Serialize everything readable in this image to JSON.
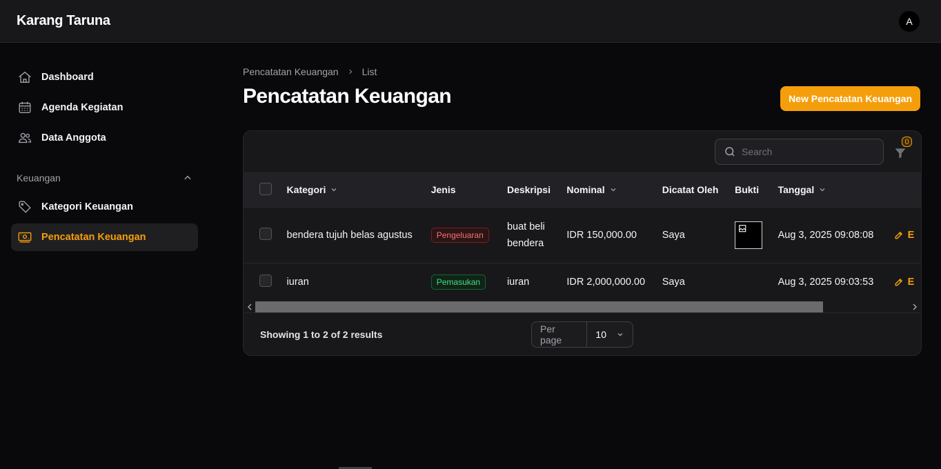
{
  "app": {
    "title": "Karang Taruna",
    "user_initial": "A"
  },
  "sidebar": {
    "items": [
      {
        "label": "Dashboard",
        "icon": "home-icon"
      },
      {
        "label": "Agenda Kegiatan",
        "icon": "calendar-icon"
      },
      {
        "label": "Data Anggota",
        "icon": "users-icon"
      }
    ],
    "group": {
      "label": "Keuangan",
      "items": [
        {
          "label": "Kategori Keuangan",
          "icon": "tag-icon"
        },
        {
          "label": "Pencatatan Keuangan",
          "icon": "banknotes-icon",
          "active": true
        }
      ]
    }
  },
  "breadcrumb": {
    "parent": "Pencatatan Keuangan",
    "current": "List"
  },
  "page": {
    "title": "Pencatatan Keuangan",
    "new_button": "New Pencatatan Keuangan"
  },
  "table": {
    "search_placeholder": "Search",
    "filter_count": "0",
    "columns": [
      "Kategori",
      "Jenis",
      "Deskripsi",
      "Nominal",
      "Dicatat Oleh",
      "Bukti",
      "Tanggal"
    ],
    "rows": [
      {
        "kategori": "bendera tujuh belas agustus",
        "jenis": "Pengeluaran",
        "deskripsi_1": "buat beli",
        "deskripsi_2": "bendera",
        "nominal": "IDR 150,000.00",
        "dicatat_oleh": "Saya",
        "bukti": true,
        "tanggal": "Aug 3, 2025 09:08:08",
        "action": "E"
      },
      {
        "kategori": "iuran",
        "jenis": "Pemasukan",
        "deskripsi_1": "iuran",
        "nominal": "IDR 2,000,000.00",
        "dicatat_oleh": "Saya",
        "bukti": false,
        "tanggal": "Aug 3, 2025 09:03:53",
        "action": "E"
      }
    ],
    "footer": {
      "results": "Showing 1 to 2 of 2 results",
      "per_page_label": "Per page",
      "per_page_value": "10"
    }
  },
  "colors": {
    "accent": "#f59e0b",
    "background": "#09090b",
    "surface": "#18181b"
  }
}
